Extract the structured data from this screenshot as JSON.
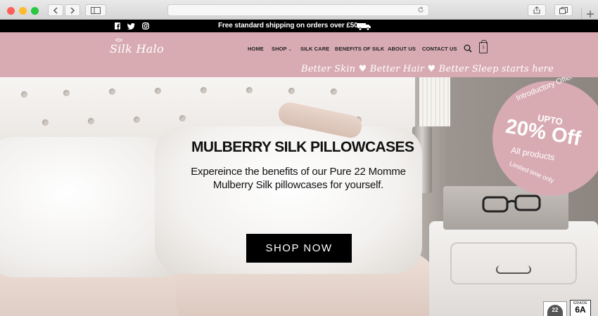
{
  "announcement": {
    "shipping_text": "Free standard shipping on orders over £50",
    "social_icons": [
      "facebook-icon",
      "twitter-icon",
      "instagram-icon"
    ]
  },
  "header": {
    "logo_text": "Silk Halo",
    "nav": [
      {
        "label": "HOME"
      },
      {
        "label": "SHOP",
        "has_dropdown": true
      },
      {
        "label": "SILK CARE"
      },
      {
        "label": "BENEFITS OF SILK"
      },
      {
        "label": "ABOUT US"
      },
      {
        "label": "CONTACT US"
      }
    ],
    "cart_count": "1",
    "tagline": "Better Skin ♥ Better Hair ♥ Better Sleep starts here"
  },
  "hero": {
    "title": "MULBERRY SILK PILLOWCASES",
    "subtitle": "Expereince the benefits of our Pure 22 Momme Mulberry Silk pillowcases for yourself.",
    "cta_label": "SHOP NOW"
  },
  "promo": {
    "line1": "Introductory Offer",
    "line2": "UPTO",
    "line3": "20% Off",
    "line4": "All products",
    "line5": "Limited time only"
  },
  "badges": {
    "momme": "22",
    "grade_label": "GRADE",
    "grade_value": "6A"
  },
  "colors": {
    "brand_pink": "#d8abb3",
    "topbar": "#000000",
    "cta": "#000000"
  }
}
